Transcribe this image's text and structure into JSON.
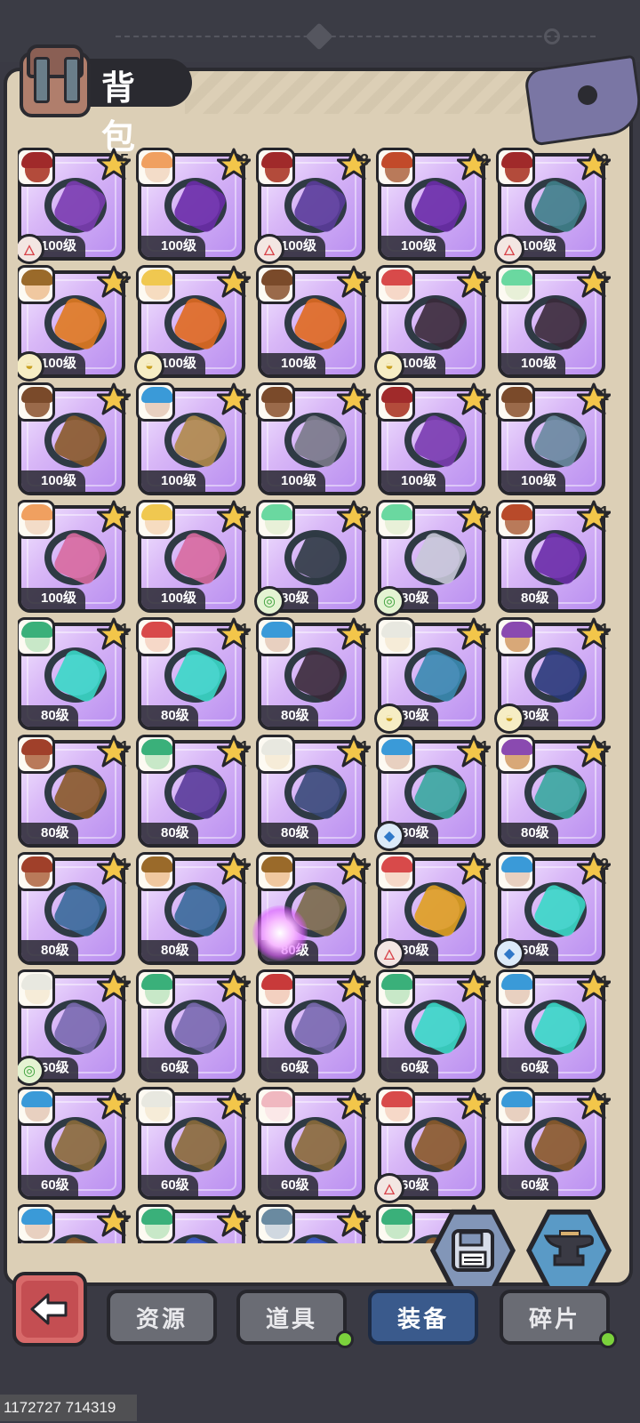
{
  "title": "背包",
  "colors": {
    "card_bg": "#d9b8f7",
    "active_tab": "#3a5a8c",
    "panel": "#dccfb6"
  },
  "items": [
    {
      "level": "100级",
      "stars": "5",
      "element": "fire",
      "art": "#7a3cb0",
      "hair": "#a02a2a",
      "face": "#b34b3b"
    },
    {
      "level": "100级",
      "stars": "3",
      "element": null,
      "art": "#6a2ca8",
      "hair": "#f0a060",
      "face": "#f3dcc8"
    },
    {
      "level": "100级",
      "stars": "3",
      "element": "fire",
      "art": "#5a3c9a",
      "hair": "#a02a2a",
      "face": "#b34b3b"
    },
    {
      "level": "100级",
      "stars": "2",
      "element": null,
      "art": "#6a2ca8",
      "hair": "#c24a2a",
      "face": "#b97a5a"
    },
    {
      "level": "100级",
      "stars": "2",
      "element": "fire",
      "art": "#3f7f8a",
      "hair": "#a02a2a",
      "face": "#b34b3b"
    },
    {
      "level": "100级",
      "stars": "2",
      "element": "earth",
      "art": "#e07a20",
      "hair": "#9a6a2a",
      "face": "#f0c8a0"
    },
    {
      "level": "100级",
      "stars": "1",
      "element": "earth",
      "art": "#e06a20",
      "hair": "#f0c850",
      "face": "#f6dcc0"
    },
    {
      "level": "100级",
      "stars": "1",
      "element": null,
      "art": "#e06a20",
      "hair": "#7a4a2a",
      "face": "#9a6a4a"
    },
    {
      "level": "100级",
      "stars": "1",
      "element": "earth",
      "art": "#3a2a3a",
      "hair": "#d84a4a",
      "face": "#f6d8c8"
    },
    {
      "level": "100级",
      "stars": "1",
      "element": null,
      "art": "#3a2a3a",
      "hair": "#6ad8a0",
      "face": "#e8f0d8"
    },
    {
      "level": "100级",
      "stars": "1",
      "element": null,
      "art": "#8a5a2a",
      "hair": "#7a4a2a",
      "face": "#9a6a4a"
    },
    {
      "level": "100级",
      "stars": "1",
      "element": null,
      "art": "#b08a4a",
      "hair": "#3a9ad8",
      "face": "#e8d0c0"
    },
    {
      "level": "100级",
      "stars": "1",
      "element": null,
      "art": "#7a7a8a",
      "hair": "#7a4a2a",
      "face": "#9a6a4a"
    },
    {
      "level": "100级",
      "stars": "1",
      "element": null,
      "art": "#7a3cb0",
      "hair": "#a02a2a",
      "face": "#b34b3b"
    },
    {
      "level": "100级",
      "stars": "1",
      "element": null,
      "art": "#6a8aa0",
      "hair": "#7a4a2a",
      "face": "#9a6a4a"
    },
    {
      "level": "100级",
      "stars": "1",
      "element": null,
      "art": "#d86aa0",
      "hair": "#f0a060",
      "face": "#f3dcc8"
    },
    {
      "level": "100级",
      "stars": "1",
      "element": null,
      "art": "#d86aa0",
      "hair": "#f0c850",
      "face": "#f6dcc0"
    },
    {
      "level": "80级",
      "stars": "3",
      "element": "nature",
      "art": "#2f3a44",
      "hair": "#6ad8a0",
      "face": "#e8f0d8"
    },
    {
      "level": "80级",
      "stars": "2",
      "element": "nature",
      "art": "#c8c8d8",
      "hair": "#6ad8a0",
      "face": "#e8f0d8"
    },
    {
      "level": "80级",
      "stars": "1",
      "element": null,
      "art": "#6a2ca8",
      "hair": "#b84a2a",
      "face": "#b97a5a"
    },
    {
      "level": "80级",
      "stars": "1",
      "element": null,
      "art": "#3ad8c8",
      "hair": "#3ab07a",
      "face": "#c8e8c8"
    },
    {
      "level": "80级",
      "stars": "1",
      "element": null,
      "art": "#3ad8c8",
      "hair": "#d84a4a",
      "face": "#f6d8c8"
    },
    {
      "level": "80级",
      "stars": "1",
      "element": null,
      "art": "#3a2a3a",
      "hair": "#3a9ad8",
      "face": "#e8d0c0"
    },
    {
      "level": "80级",
      "stars": "1",
      "element": "earth",
      "art": "#3a8ab0",
      "hair": "#e8e8e0",
      "face": "#f6ecd8"
    },
    {
      "level": "80级",
      "stars": "1",
      "element": "earth",
      "art": "#2a3a7a",
      "hair": "#8a4ab0",
      "face": "#d8a878"
    },
    {
      "level": "80级",
      "stars": "1",
      "element": null,
      "art": "#8a5a2a",
      "hair": "#a0402a",
      "face": "#b97a5a"
    },
    {
      "level": "80级",
      "stars": "1",
      "element": null,
      "art": "#5a3c9a",
      "hair": "#3ab07a",
      "face": "#c8e8c8"
    },
    {
      "level": "80级",
      "stars": "1",
      "element": null,
      "art": "#3a4a7a",
      "hair": "#e8e8e0",
      "face": "#f6ecd8"
    },
    {
      "level": "80级",
      "stars": "1",
      "element": "water",
      "art": "#3aa8a0",
      "hair": "#3a9ad8",
      "face": "#e8d0c0"
    },
    {
      "level": "80级",
      "stars": "1",
      "element": null,
      "art": "#3aa8a0",
      "hair": "#8a4ab0",
      "face": "#d8a878"
    },
    {
      "level": "80级",
      "stars": "1",
      "element": null,
      "art": "#3a6a9a",
      "hair": "#a0402a",
      "face": "#b97a5a"
    },
    {
      "level": "80级",
      "stars": "1",
      "element": null,
      "art": "#3a6a9a",
      "hair": "#9a6a2a",
      "face": "#f0c8a0"
    },
    {
      "level": "80级",
      "stars": "1",
      "element": null,
      "art": "#7a6a4a",
      "hair": "#9a6a2a",
      "face": "#f0c8a0"
    },
    {
      "level": "80级",
      "stars": "1",
      "element": "fire",
      "art": "#e0a020",
      "hair": "#d84a4a",
      "face": "#f6d8c8"
    },
    {
      "level": "60级",
      "stars": "2",
      "element": "water",
      "art": "#3ad8c8",
      "hair": "#3a9ad8",
      "face": "#e8d0c0"
    },
    {
      "level": "60级",
      "stars": "1",
      "element": "nature",
      "art": "#7a6ab0",
      "hair": "#e8e8e0",
      "face": "#f6ecd8"
    },
    {
      "level": "60级",
      "stars": "1",
      "element": null,
      "art": "#7a6ab0",
      "hair": "#3ab07a",
      "face": "#c8e8c8"
    },
    {
      "level": "60级",
      "stars": "1",
      "element": null,
      "art": "#7a6ab0",
      "hair": "#c83a3a",
      "face": "#f3d0c0"
    },
    {
      "level": "60级",
      "stars": "1",
      "element": null,
      "art": "#3ad8c8",
      "hair": "#3ab07a",
      "face": "#c8e8c8"
    },
    {
      "level": "60级",
      "stars": "1",
      "element": null,
      "art": "#3ad8c8",
      "hair": "#3a9ad8",
      "face": "#e8d0c0"
    },
    {
      "level": "60级",
      "stars": "1",
      "element": null,
      "art": "#8a6a3a",
      "hair": "#3a9ad8",
      "face": "#e8d0c0"
    },
    {
      "level": "60级",
      "stars": "1",
      "element": null,
      "art": "#8a6a3a",
      "hair": "#e8e8e0",
      "face": "#f6ecd8"
    },
    {
      "level": "60级",
      "stars": "1",
      "element": null,
      "art": "#8a6a3a",
      "hair": "#f0b8c0",
      "face": "#fbe8e8"
    },
    {
      "level": "60级",
      "stars": "1",
      "element": "fire",
      "art": "#8a5a2a",
      "hair": "#d84a4a",
      "face": "#f6d8c8"
    },
    {
      "level": "60级",
      "stars": "1",
      "element": null,
      "art": "#8a5a2a",
      "hair": "#3a9ad8",
      "face": "#e8d0c0"
    },
    {
      "level": "",
      "stars": "1",
      "element": null,
      "art": "#8a5a2a",
      "hair": "#3a9ad8",
      "face": "#e8d0c0"
    },
    {
      "level": "",
      "stars": "1",
      "element": null,
      "art": "#3a5ac8",
      "hair": "#3ab07a",
      "face": "#c8e8c8"
    },
    {
      "level": "",
      "stars": "1",
      "element": null,
      "art": "#3a5ac8",
      "hair": "#6a8aa0",
      "face": "#d0d8e0"
    },
    {
      "level": "",
      "stars": "1",
      "element": null,
      "art": "#8a5a2a",
      "hair": "#3ab07a",
      "face": "#c8e8c8"
    }
  ],
  "tabs": [
    {
      "label": "资源",
      "active": false,
      "dot": false
    },
    {
      "label": "道具",
      "active": false,
      "dot": true
    },
    {
      "label": "装备",
      "active": true,
      "dot": false
    },
    {
      "label": "碎片",
      "active": false,
      "dot": true
    }
  ],
  "watermark": "1172727 714319"
}
